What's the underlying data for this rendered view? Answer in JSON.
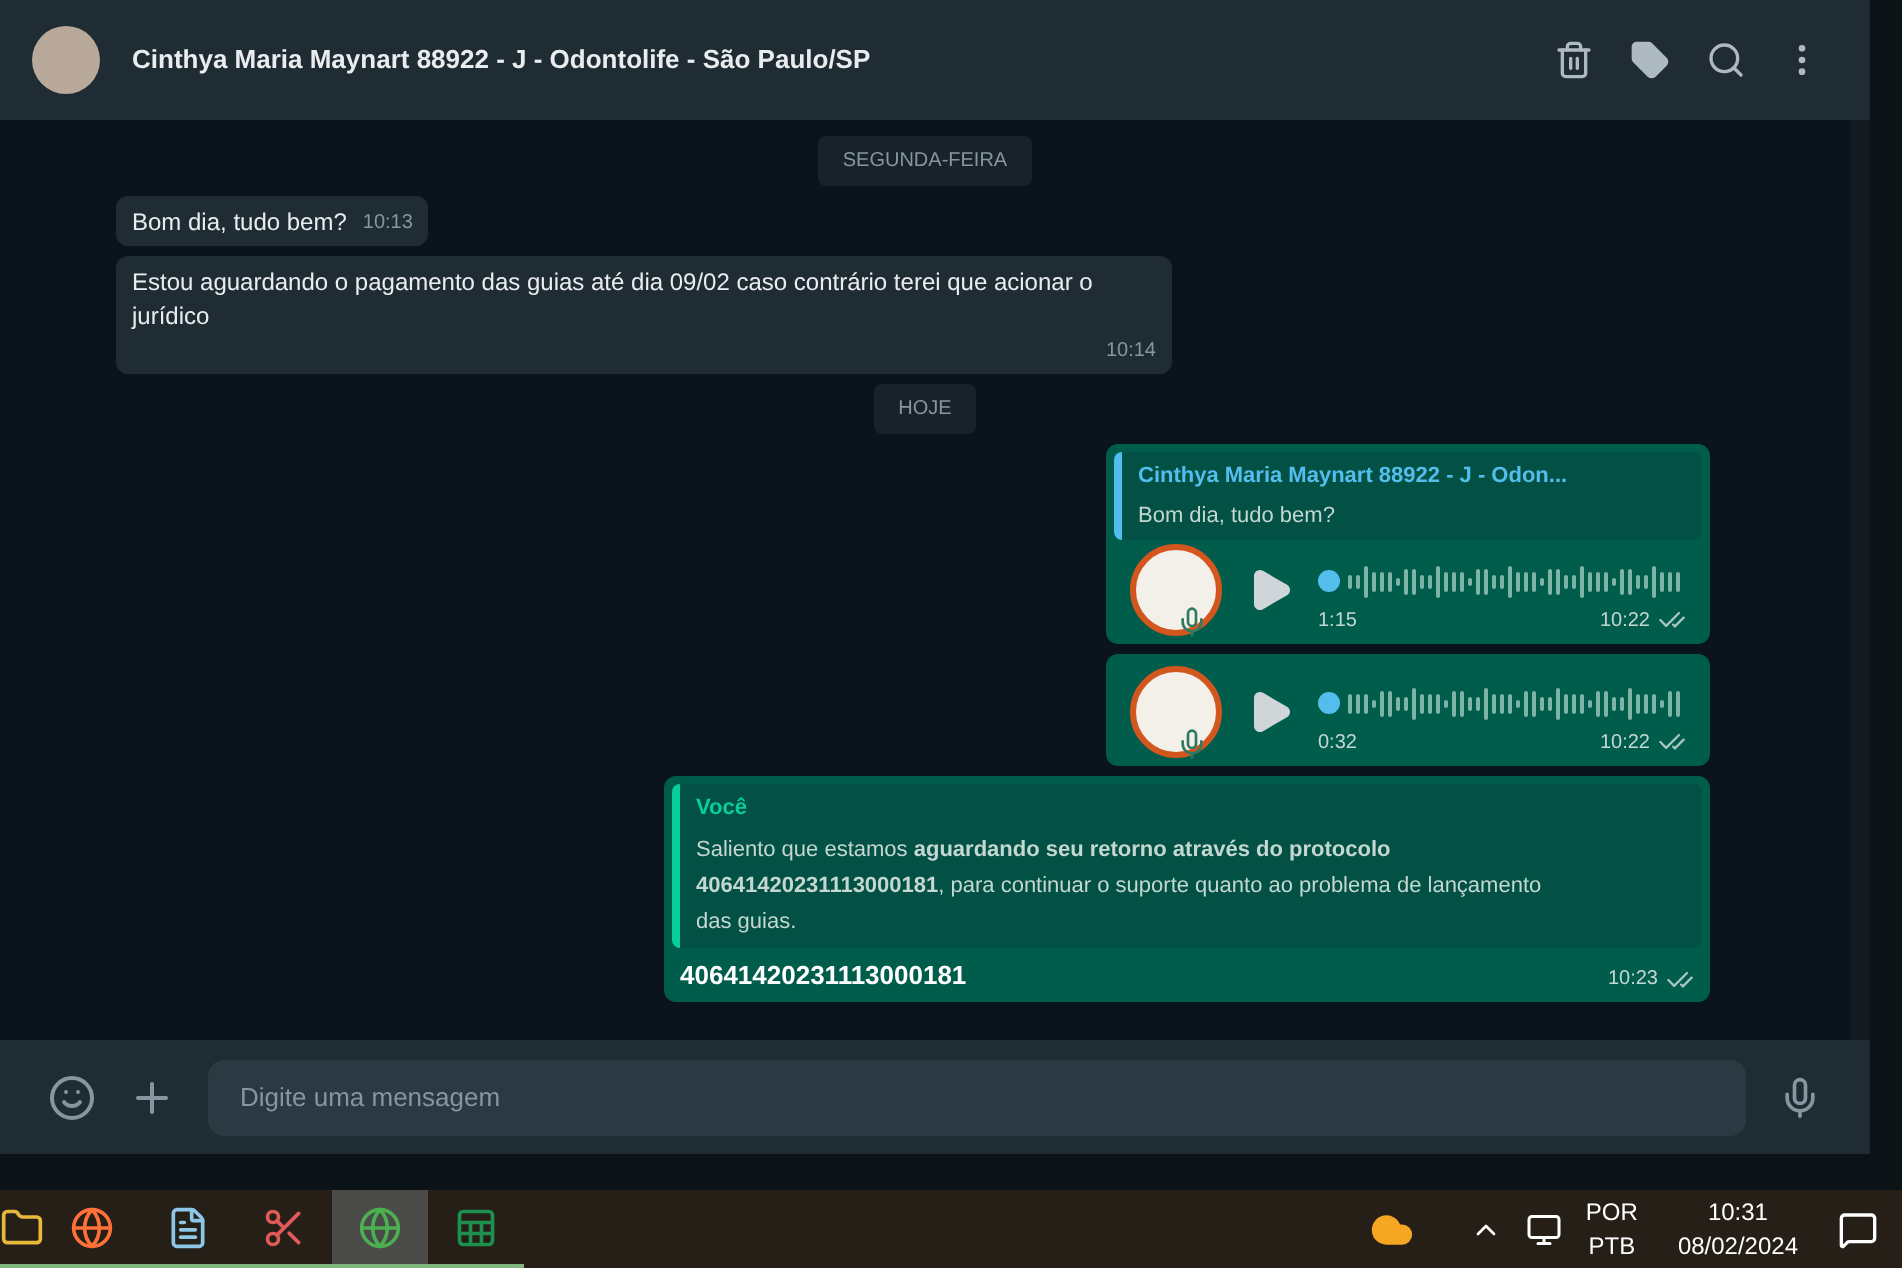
{
  "header": {
    "title": "Cinthya Maria Maynart 88922 - J - Odontolife - São Paulo/SP"
  },
  "messages": [
    {
      "kind": "date",
      "text": "SEGUNDA-FEIRA"
    },
    {
      "kind": "incoming",
      "text": "Bom dia, tudo bem?",
      "time": "10:13"
    },
    {
      "kind": "incoming",
      "text": "Estou aguardando o pagamento das guias até dia 09/02 caso contrário terei que acionar o jurídico",
      "time": "10:14"
    },
    {
      "kind": "date",
      "text": "HOJE"
    },
    {
      "kind": "audio",
      "quote": {
        "author": "Cinthya Maria Maynart 88922 - J - Odon...",
        "text": "Bom dia, tudo bem?"
      },
      "duration": "1:15",
      "time": "10:22",
      "read": true
    },
    {
      "kind": "audio",
      "duration": "0:32",
      "time": "10:22",
      "read": true
    },
    {
      "kind": "reply",
      "quote": {
        "author": "Você",
        "text": "Saliento que estamos **aguardando seu retorno através do protocolo 40641420231113000181**, para continuar o suporte quanto ao problema de lançamento das guias."
      },
      "text": "40641420231113000181",
      "time": "10:23",
      "read": true
    }
  ],
  "composer": {
    "placeholder": "Digite uma mensagem"
  },
  "taskbar": {
    "apps": [
      {
        "kind": "folder",
        "selected": false
      },
      {
        "kind": "firefox",
        "selected": false
      },
      {
        "kind": "notepad",
        "selected": false
      },
      {
        "kind": "snip",
        "selected": false
      },
      {
        "kind": "chrome",
        "selected": true
      },
      {
        "kind": "excel",
        "selected": false
      }
    ],
    "language": "POR",
    "layout": "PTB",
    "time": "10:31",
    "date": "08/02/2024"
  }
}
